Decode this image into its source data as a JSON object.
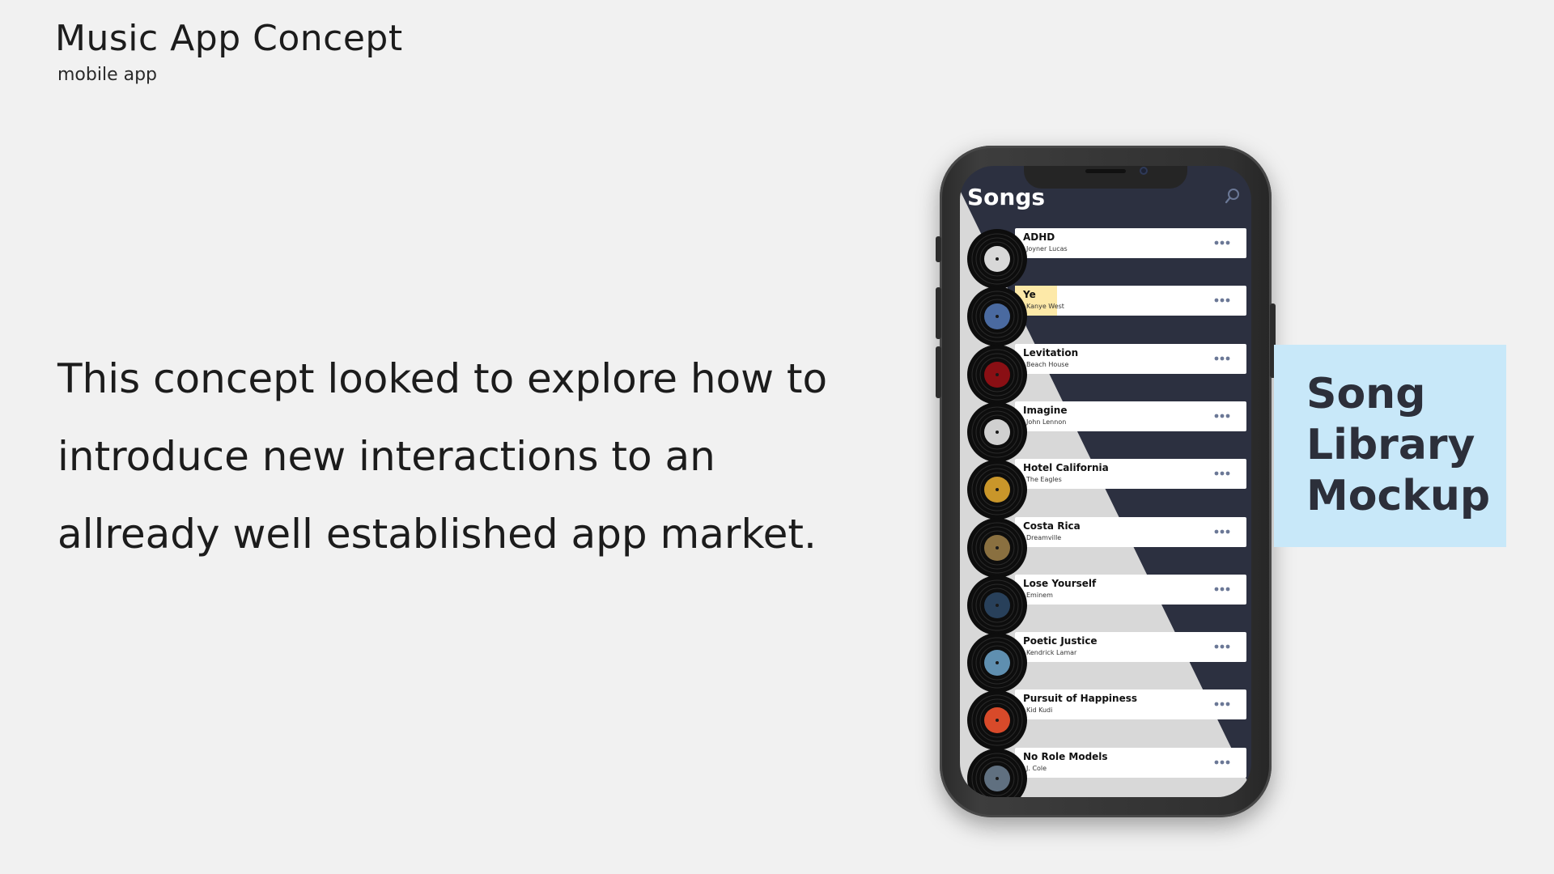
{
  "header": {
    "title": "Music App Concept",
    "subtitle": "mobile app"
  },
  "description": {
    "lines": [
      "This concept looked to explore how to",
      "introduce new interactions to an",
      "allready well established app market."
    ]
  },
  "app": {
    "screen_title": "Songs",
    "search_icon": "search-icon",
    "more_icon": "more-options-icon",
    "songs": [
      {
        "title": "ADHD",
        "artist": "Joyner Lucas",
        "art_color": "#d8d8d8"
      },
      {
        "title": "Ye",
        "artist": "Kanye West",
        "art_color": "#4a6aa0"
      },
      {
        "title": "Levitation",
        "artist": "Beach House",
        "art_color": "#8a0f14"
      },
      {
        "title": "Imagine",
        "artist": "John Lennon",
        "art_color": "#d0d0d0"
      },
      {
        "title": "Hotel California",
        "artist": "The Eagles",
        "art_color": "#c9962a"
      },
      {
        "title": "Costa Rica",
        "artist": "Dreamville",
        "art_color": "#8a7040"
      },
      {
        "title": "Lose Yourself",
        "artist": "Eminem",
        "art_color": "#28405a"
      },
      {
        "title": "Poetic Justice",
        "artist": "Kendrick Lamar",
        "art_color": "#5f8fb0"
      },
      {
        "title": "Pursuit of Happiness",
        "artist": "Kid Kudi",
        "art_color": "#d84a2a"
      },
      {
        "title": "No Role Models",
        "artist": "J. Cole",
        "art_color": "#607080"
      }
    ]
  },
  "callout": {
    "lines": [
      "Song",
      "Library",
      "Mockup"
    ]
  },
  "colors": {
    "background": "#f1f1f1",
    "screen_dark": "#2c3040",
    "screen_light": "#d8d8d8",
    "highlight": "#fde9a8",
    "callout": "#c8e8f9"
  }
}
